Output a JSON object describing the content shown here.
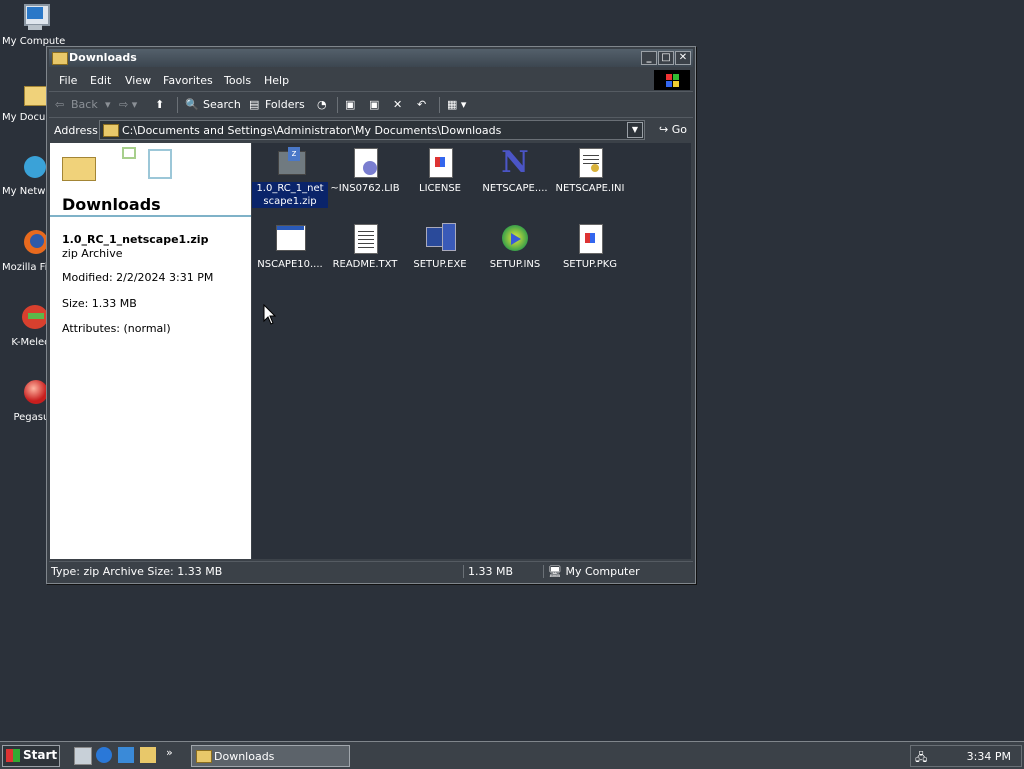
{
  "desktop": {
    "icons": [
      {
        "label": "My Computer",
        "icon": "computer-icon"
      },
      {
        "label": "My Documents",
        "icon": "documents-folder-icon"
      },
      {
        "label": "My Network Places",
        "icon": "network-icon"
      },
      {
        "label": "Mozilla Firefox",
        "icon": "firefox-icon"
      },
      {
        "label": "K-Meleon",
        "icon": "kmeleon-icon"
      },
      {
        "label": "Pegasus",
        "icon": "pegasus-icon"
      }
    ]
  },
  "window": {
    "title": "Downloads",
    "buttons": {
      "minimize": "_",
      "maximize": "□",
      "close": "✕"
    },
    "menu": [
      "File",
      "Edit",
      "View",
      "Favorites",
      "Tools",
      "Help"
    ],
    "toolbar": {
      "back": "Back",
      "search": "Search",
      "folders": "Folders"
    },
    "address": {
      "label": "Address",
      "value": "C:\\Documents and Settings\\Administrator\\My Documents\\Downloads",
      "go": "Go"
    },
    "details": {
      "folder_title": "Downloads",
      "file_name": "1.0_RC_1_netscape1.zip",
      "file_type": "zip Archive",
      "modified": "Modified: 2/2/2024 3:31 PM",
      "size": "Size: 1.33 MB",
      "attributes": "Attributes: (normal)"
    },
    "files": [
      {
        "name": "1.0_RC_1_netscape1.zip",
        "display": "1.0_RC_1_net scape1.zip",
        "icon": "zip-icon",
        "selected": true
      },
      {
        "name": "~INS0762.LIB",
        "display": "~INS0762.LIB",
        "icon": "lib-icon",
        "selected": false
      },
      {
        "name": "LICENSE",
        "display": "LICENSE",
        "icon": "license-icon",
        "selected": false
      },
      {
        "name": "NETSCAPE....",
        "display": "NETSCAPE....",
        "icon": "netscape-icon",
        "selected": false
      },
      {
        "name": "NETSCAPE.INI",
        "display": "NETSCAPE.INI",
        "icon": "ini-icon",
        "selected": false
      },
      {
        "name": "NSCAPE10....",
        "display": "NSCAPE10....",
        "icon": "window-icon",
        "selected": false
      },
      {
        "name": "README.TXT",
        "display": "README.TXT",
        "icon": "text-file-icon",
        "selected": false
      },
      {
        "name": "SETUP.EXE",
        "display": "SETUP.EXE",
        "icon": "setup-exe-icon",
        "selected": false
      },
      {
        "name": "SETUP.INS",
        "display": "SETUP.INS",
        "icon": "setup-ins-icon",
        "selected": false
      },
      {
        "name": "SETUP.PKG",
        "display": "SETUP.PKG",
        "icon": "pkg-icon",
        "selected": false
      }
    ],
    "status": {
      "left": "Type: zip Archive Size: 1.33 MB",
      "size": "1.33 MB",
      "zone": "My Computer"
    }
  },
  "taskbar": {
    "start": "Start",
    "task": "Downloads",
    "clock": "3:34 PM",
    "overflow": "»"
  },
  "colors": {
    "desktop": "#2b313a",
    "selection": "#0a246a",
    "panel_white": "#ffffff"
  }
}
